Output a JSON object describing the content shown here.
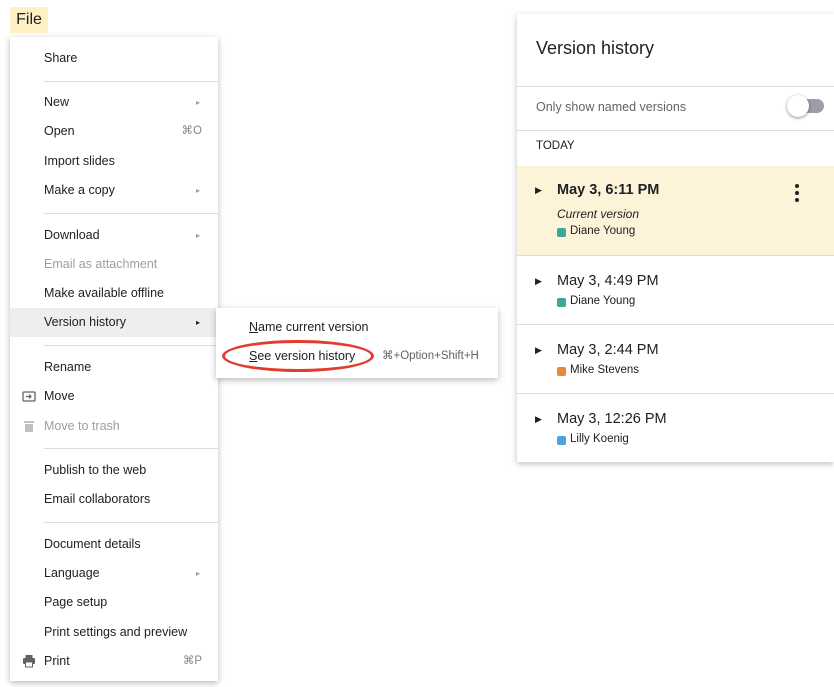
{
  "file_tab": "File",
  "file_menu": {
    "items": [
      {
        "label": "Share"
      },
      {
        "label": "New"
      },
      {
        "label": "Open",
        "shortcut": "⌘O"
      },
      {
        "label": "Import slides"
      },
      {
        "label": "Make a copy"
      },
      {
        "label": "Download"
      },
      {
        "label": "Email as attachment"
      },
      {
        "label": "Make available offline"
      },
      {
        "label": "Version history"
      },
      {
        "label": "Rename"
      },
      {
        "label": "Move"
      },
      {
        "label": "Move to trash"
      },
      {
        "label": "Publish to the web"
      },
      {
        "label": "Email collaborators"
      },
      {
        "label": "Document details"
      },
      {
        "label": "Language"
      },
      {
        "label": "Page setup"
      },
      {
        "label": "Print settings and preview"
      },
      {
        "label": "Print",
        "shortcut": "⌘P"
      }
    ]
  },
  "submenu": {
    "name_current": {
      "first": "N",
      "rest": "ame current version"
    },
    "see_history": {
      "first": "S",
      "rest": "ee version history"
    },
    "see_history_shortcut": "⌘+Option+Shift+H"
  },
  "version_panel": {
    "title": "Version history",
    "toggle_label": "Only show named versions",
    "toggle_on": false,
    "section": "TODAY",
    "versions": [
      {
        "datetime": "May 3, 6:11 PM",
        "note": "Current version",
        "user": "Diane Young",
        "color": "#3fa796"
      },
      {
        "datetime": "May 3, 4:49 PM",
        "user": "Diane Young",
        "color": "#3fa796"
      },
      {
        "datetime": "May 3, 2:44 PM",
        "user": "Mike Stevens",
        "color": "#e8893a"
      },
      {
        "datetime": "May 3, 12:26 PM",
        "user": "Lilly Koenig",
        "color": "#4ba3e3"
      }
    ]
  },
  "icons": {
    "submenu_arrow": "▸",
    "expand": "▶",
    "folder": "folder-move-icon",
    "trash": "trash-icon",
    "printer": "printer-icon",
    "more": "more-vert-icon"
  },
  "colors": {
    "file_tab_bg": "#fdf0c4",
    "selected_row_bg": "#fdf3d9",
    "highlight_circle": "#e33b2e"
  }
}
